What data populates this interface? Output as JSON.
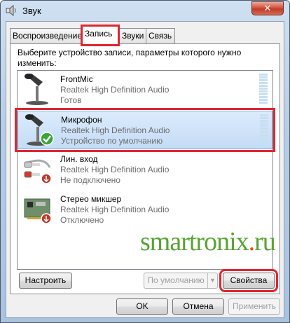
{
  "window": {
    "title": "Звук",
    "close_glyph": "✕"
  },
  "tabs": [
    {
      "label": "Воспроизведение"
    },
    {
      "label": "Запись"
    },
    {
      "label": "Звуки"
    },
    {
      "label": "Связь"
    }
  ],
  "panel": {
    "description": "Выберите устройство записи, параметры которого нужно изменить:"
  },
  "devices": [
    {
      "name": "FrontMic",
      "driver": "Realtek High Definition Audio",
      "status": "Готов",
      "icon": "microphone-icon"
    },
    {
      "name": "Микрофон",
      "driver": "Realtek High Definition Audio",
      "status": "Устройство по умолчанию",
      "icon": "microphone-default-icon"
    },
    {
      "name": "Лин. вход",
      "driver": "Realtek High Definition Audio",
      "status": "Не подключено",
      "icon": "line-in-icon"
    },
    {
      "name": "Стерео микшер",
      "driver": "Realtek High Definition Audio",
      "status": "Отключено",
      "icon": "sound-card-icon"
    }
  ],
  "watermark": {
    "text_before": "smartronix",
    "text_dot": ".",
    "text_after": "ru"
  },
  "buttons": {
    "configure": "Настроить",
    "set_default": "По умолчанию",
    "properties": "Свойства",
    "ok": "OK",
    "cancel": "Отмена",
    "apply": "Применить"
  },
  "colors": {
    "highlight": "#e0262f",
    "selected_row": "#c4dcf6",
    "watermark_green": "#58a334",
    "watermark_dot": "#ea4b1c"
  }
}
